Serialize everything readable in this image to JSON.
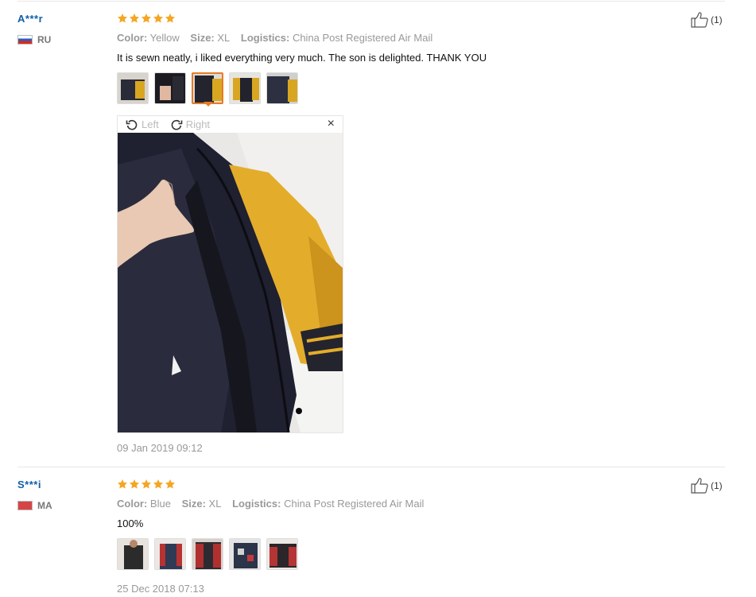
{
  "reviews": [
    {
      "user": "A***r",
      "country": "RU",
      "rating": 5,
      "attributes": [
        {
          "label": "Color:",
          "value": "Yellow"
        },
        {
          "label": "Size:",
          "value": "XL"
        },
        {
          "label": "Logistics:",
          "value": "China Post Registered Air Mail"
        }
      ],
      "text": "It is sewn neatly, i liked everything very much. The son is delighted. THANK YOU",
      "helpful_count": "(1)",
      "date": "09 Jan 2019 09:12",
      "thumbnail_count": 5,
      "active_thumbnail": 3
    },
    {
      "user": "S***i",
      "country": "MA",
      "rating": 5,
      "attributes": [
        {
          "label": "Color:",
          "value": "Blue"
        },
        {
          "label": "Size:",
          "value": "XL"
        },
        {
          "label": "Logistics:",
          "value": "China Post Registered Air Mail"
        }
      ],
      "text": "100%",
      "helpful_count": "(1)",
      "date": "25 Dec 2018 07:13",
      "thumbnail_count": 5
    }
  ],
  "viewer": {
    "rotate_left_label": "Left",
    "rotate_right_label": "Right",
    "close_symbol": "×"
  },
  "colors": {
    "star": "#f5a623",
    "username": "#0f5fa8",
    "active_thumb_border": "#e87b24"
  },
  "icons": [
    "star-icon",
    "thumbs-up-icon",
    "rotate-left-icon",
    "rotate-right-icon",
    "close-icon",
    "flag-ru-icon",
    "flag-ma-icon"
  ]
}
